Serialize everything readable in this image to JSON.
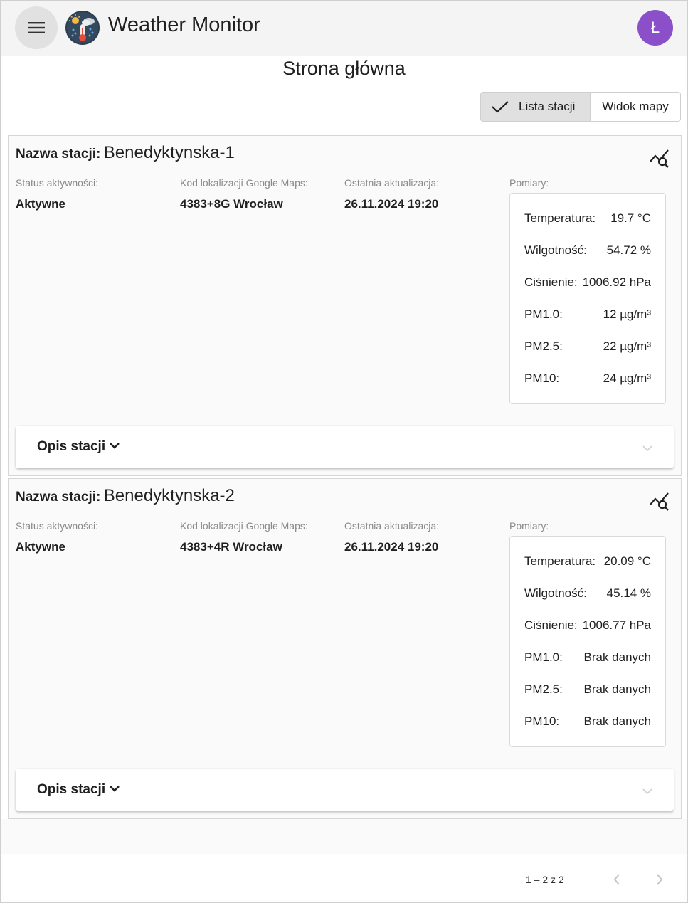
{
  "app": {
    "title": "Weather Monitor",
    "user_initial": "Ł"
  },
  "page": {
    "heading": "Strona główna"
  },
  "view_toggle": {
    "list_label": "Lista stacji",
    "map_label": "Widok mapy",
    "selected": "list"
  },
  "labels": {
    "station_name": "Nazwa stacji:",
    "status": "Status aktywności:",
    "location_code": "Kod lokalizacji Google Maps:",
    "last_update": "Ostatnia aktualizacja:",
    "measurements": "Pomiary:",
    "description": "Opis stacji"
  },
  "stations": [
    {
      "name": "Benedyktynska-1",
      "status": "Aktywne",
      "location_code": "4383+8G Wrocław",
      "last_update": "26.11.2024 19:20",
      "measurements": [
        {
          "name": "Temperatura:",
          "value": "19.7 °C"
        },
        {
          "name": "Wilgotność:",
          "value": "54.72 %"
        },
        {
          "name": "Ciśnienie:",
          "value": "1006.92 hPa"
        },
        {
          "name": "PM1.0:",
          "value": "12 µg/m³"
        },
        {
          "name": "PM2.5:",
          "value": "22 µg/m³"
        },
        {
          "name": "PM10:",
          "value": "24 µg/m³"
        }
      ]
    },
    {
      "name": "Benedyktynska-2",
      "status": "Aktywne",
      "location_code": "4383+4R Wrocław",
      "last_update": "26.11.2024 19:20",
      "measurements": [
        {
          "name": "Temperatura:",
          "value": "20.09 °C"
        },
        {
          "name": "Wilgotność:",
          "value": "45.14 %"
        },
        {
          "name": "Ciśnienie:",
          "value": "1006.77 hPa"
        },
        {
          "name": "PM1.0:",
          "value": "Brak danych"
        },
        {
          "name": "PM2.5:",
          "value": "Brak danych"
        },
        {
          "name": "PM10:",
          "value": "Brak danych"
        }
      ]
    }
  ],
  "pagination": {
    "range_label": "1 – 2 z 2"
  },
  "colors": {
    "avatar": "#8a4fc9",
    "topbar": "#f4f4f4",
    "toggle_active": "#e0e0e0"
  }
}
